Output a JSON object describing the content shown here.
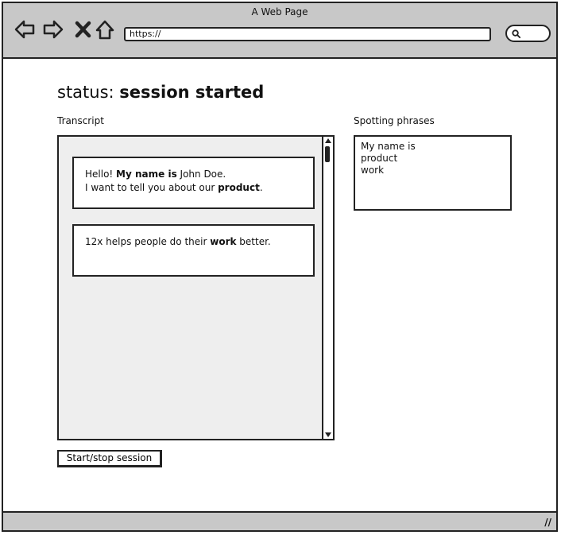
{
  "window": {
    "title": "A Web Page"
  },
  "browser": {
    "url": "https://",
    "icons": {
      "back": "arrow-left-icon",
      "forward": "arrow-right-icon",
      "stop": "close-icon",
      "home": "home-icon",
      "search": "search-icon"
    }
  },
  "status": {
    "prefix": "status:",
    "value": "session started"
  },
  "transcript": {
    "label": "Transcript",
    "entries": [
      {
        "line1": {
          "t1": "Hello! ",
          "b1": "My name is",
          "t2": " John Doe."
        },
        "line2": {
          "t1": "I want to tell you about our ",
          "b1": "product",
          "t2": "."
        }
      },
      {
        "line1": {
          "t1": "12x helps people do their ",
          "b1": "work",
          "t2": " better."
        }
      }
    ]
  },
  "spotting": {
    "label": "Spotting phrases",
    "phrases": [
      "My name is",
      "product",
      "work"
    ]
  },
  "session_button": {
    "label": "Start/stop session"
  },
  "colors": {
    "chrome": "#c8c8c8",
    "transcript_bg": "#eeeeee",
    "border": "#222222"
  }
}
